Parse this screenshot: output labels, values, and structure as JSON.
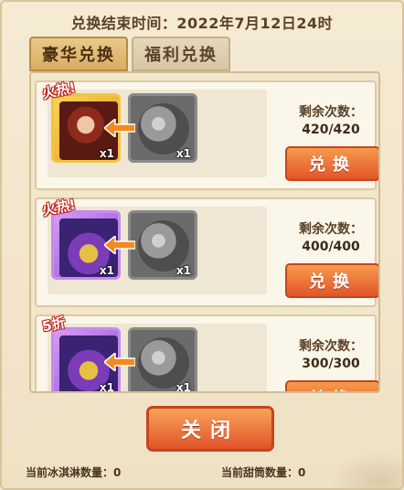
{
  "header": {
    "deadline_text": "兑换结束时间：2022年7月12日24时"
  },
  "tabs": [
    {
      "label": "豪华兑换",
      "active": true
    },
    {
      "label": "福利兑换",
      "active": false
    }
  ],
  "cards": [
    {
      "tag": "火热!",
      "reward_count": "x1",
      "cost_count": "x1",
      "remaining_label": "剩余次数：",
      "remaining_value": "420/420",
      "button_label": "兑换"
    },
    {
      "tag": "火热!",
      "reward_count": "x1",
      "cost_count": "x1",
      "remaining_label": "剩余次数：",
      "remaining_value": "400/400",
      "button_label": "兑换"
    },
    {
      "tag": "5折",
      "reward_count": "x1",
      "cost_count": "x1",
      "remaining_label": "剩余次数：",
      "remaining_value": "300/300",
      "button_label": "兑换"
    }
  ],
  "close_button": "关闭",
  "footer": {
    "icecream_label": "当前冰淇淋数量：0",
    "cone_label": "当前甜筒数量：0"
  },
  "colors": {
    "accent_orange": "#e2552a",
    "tag_red": "#c0201a",
    "panel_bg": "#f5ead3"
  },
  "icons": {
    "hero_icon": "hero-portrait-icon",
    "chest_icon": "treasure-chest-icon",
    "currency_icon": "icecream-cone-icon",
    "arrow_icon": "exchange-arrow-icon"
  }
}
